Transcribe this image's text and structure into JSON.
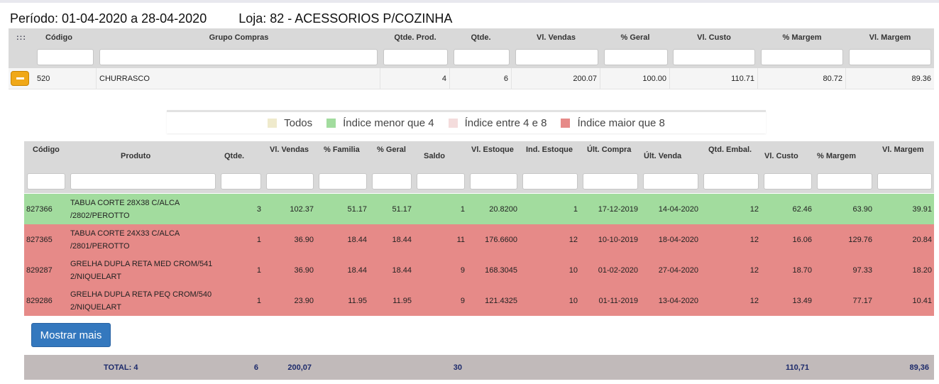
{
  "header": {
    "period": "Período: 01-04-2020 a 28-04-2020",
    "store": "Loja: 82 - ACESSORIOS P/COZINHA"
  },
  "outer_table": {
    "menu_icon": ":::",
    "columns": [
      "Código",
      "Grupo Compras",
      "Qtde. Prod.",
      "Qtde.",
      "Vl. Vendas",
      "% Geral",
      "Vl. Custo",
      "% Margem",
      "Vl. Margem"
    ],
    "row": {
      "codigo": "520",
      "grupo": "CHURRASCO",
      "qtde_prod": "4",
      "qtde": "6",
      "vl_vendas": "200.07",
      "pct_geral": "100.00",
      "vl_custo": "110.71",
      "pct_margem": "80.72",
      "vl_margem": "89.36"
    }
  },
  "legend": [
    {
      "label": "Todos",
      "color": "#efeacc"
    },
    {
      "label": "Índice menor que 4",
      "color": "#a2dc9e"
    },
    {
      "label": "Índice entre 4 e 8",
      "color": "#f4dcdc"
    },
    {
      "label": "Índice maior que 8",
      "color": "#e68a88"
    }
  ],
  "inner_table": {
    "columns": [
      "Código",
      "Produto",
      "Qtde.",
      "Vl. Vendas",
      "% Familia",
      "% Geral",
      "Saldo",
      "Vl. Estoque",
      "Ind. Estoque",
      "Últ. Compra",
      "Últ. Venda",
      "Qtd. Embal.",
      "Vl. Custo",
      "% Margem",
      "Vl. Margem"
    ],
    "rows": [
      {
        "codigo": "827366",
        "produto_l1": "TABUA CORTE 28X38 C/ALCA",
        "produto_l2": "/2802/PEROTTO",
        "qtde": "3",
        "vl_vendas": "102.37",
        "pct_familia": "51.17",
        "pct_geral": "51.17",
        "saldo": "1",
        "vl_estoque": "20.8200",
        "ind_estoque": "1",
        "ult_compra": "17-12-2019",
        "ult_venda": "14-04-2020",
        "qtd_embal": "12",
        "vl_custo": "62.46",
        "pct_margem": "63.90",
        "vl_margem": "39.91",
        "color": "#a2dc9e"
      },
      {
        "codigo": "827365",
        "produto_l1": "TABUA CORTE 24X33 C/ALCA",
        "produto_l2": "/2801/PEROTTO",
        "qtde": "1",
        "vl_vendas": "36.90",
        "pct_familia": "18.44",
        "pct_geral": "18.44",
        "saldo": "11",
        "vl_estoque": "176.6600",
        "ind_estoque": "12",
        "ult_compra": "10-10-2019",
        "ult_venda": "18-04-2020",
        "qtd_embal": "12",
        "vl_custo": "16.06",
        "pct_margem": "129.76",
        "vl_margem": "20.84",
        "color": "#e68a88"
      },
      {
        "codigo": "829287",
        "produto_l1": "GRELHA DUPLA RETA MED CROM/541",
        "produto_l2": "2/NIQUELART",
        "qtde": "1",
        "vl_vendas": "36.90",
        "pct_familia": "18.44",
        "pct_geral": "18.44",
        "saldo": "9",
        "vl_estoque": "168.3045",
        "ind_estoque": "10",
        "ult_compra": "01-02-2020",
        "ult_venda": "27-04-2020",
        "qtd_embal": "12",
        "vl_custo": "18.70",
        "pct_margem": "97.33",
        "vl_margem": "18.20",
        "color": "#e68a88"
      },
      {
        "codigo": "829286",
        "produto_l1": "GRELHA DUPLA RETA PEQ CROM/540",
        "produto_l2": "2/NIQUELART",
        "qtde": "1",
        "vl_vendas": "23.90",
        "pct_familia": "11.95",
        "pct_geral": "11.95",
        "saldo": "9",
        "vl_estoque": "121.4325",
        "ind_estoque": "10",
        "ult_compra": "01-11-2019",
        "ult_venda": "13-04-2020",
        "qtd_embal": "12",
        "vl_custo": "13.49",
        "pct_margem": "77.17",
        "vl_margem": "10.41",
        "color": "#e68a88"
      }
    ]
  },
  "show_more_label": "Mostrar mais",
  "totals": {
    "label": "TOTAL: 4",
    "qtde": "6",
    "vl_vendas": "200,07",
    "saldo": "30",
    "vl_custo": "110,71",
    "vl_margem": "89,36"
  }
}
